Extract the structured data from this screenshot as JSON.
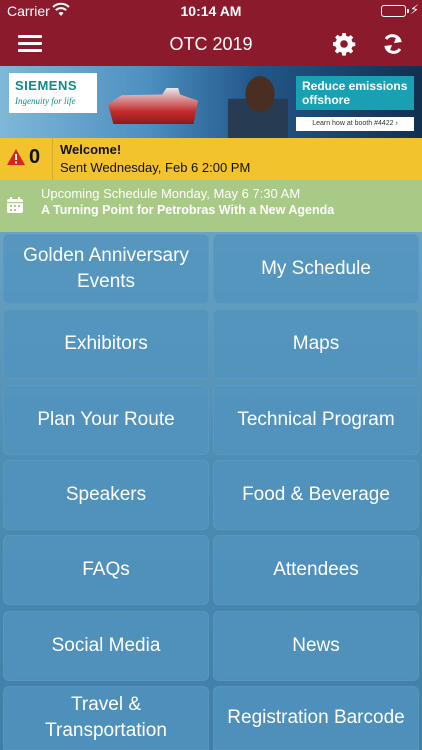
{
  "status_bar": {
    "carrier": "Carrier",
    "time": "10:14 AM",
    "battery_level": 1.0
  },
  "nav": {
    "title": "OTC 2019",
    "menu_icon": "hamburger-menu-icon",
    "settings_icon": "gear-icon",
    "refresh_icon": "refresh-icon"
  },
  "banner": {
    "brand": "SIEMENS",
    "tagline": "Ingenuity for life",
    "headline": "Reduce emissions offshore",
    "cta": "Learn how at booth #4422 ›"
  },
  "alert": {
    "count": "0",
    "title": "Welcome!",
    "text": "Sent Wednesday, Feb 6 2:00 PM"
  },
  "schedule": {
    "time": "Upcoming Schedule Monday, May 6 7:30 AM",
    "title": "A Turning Point for Petrobras With a New Agenda"
  },
  "tiles": [
    "Golden Anniversary Events",
    "My Schedule",
    "Exhibitors",
    "Maps",
    "Plan Your Route",
    "Technical Program",
    "Speakers",
    "Food & Beverage",
    "FAQs",
    "Attendees",
    "Social Media",
    "News",
    "Travel & Transportation",
    "Registration Barcode"
  ],
  "colors": {
    "brand": "#8b1a2c",
    "alert": "#f2c32d",
    "schedule": "#a9c986",
    "tile": "#5294be"
  }
}
